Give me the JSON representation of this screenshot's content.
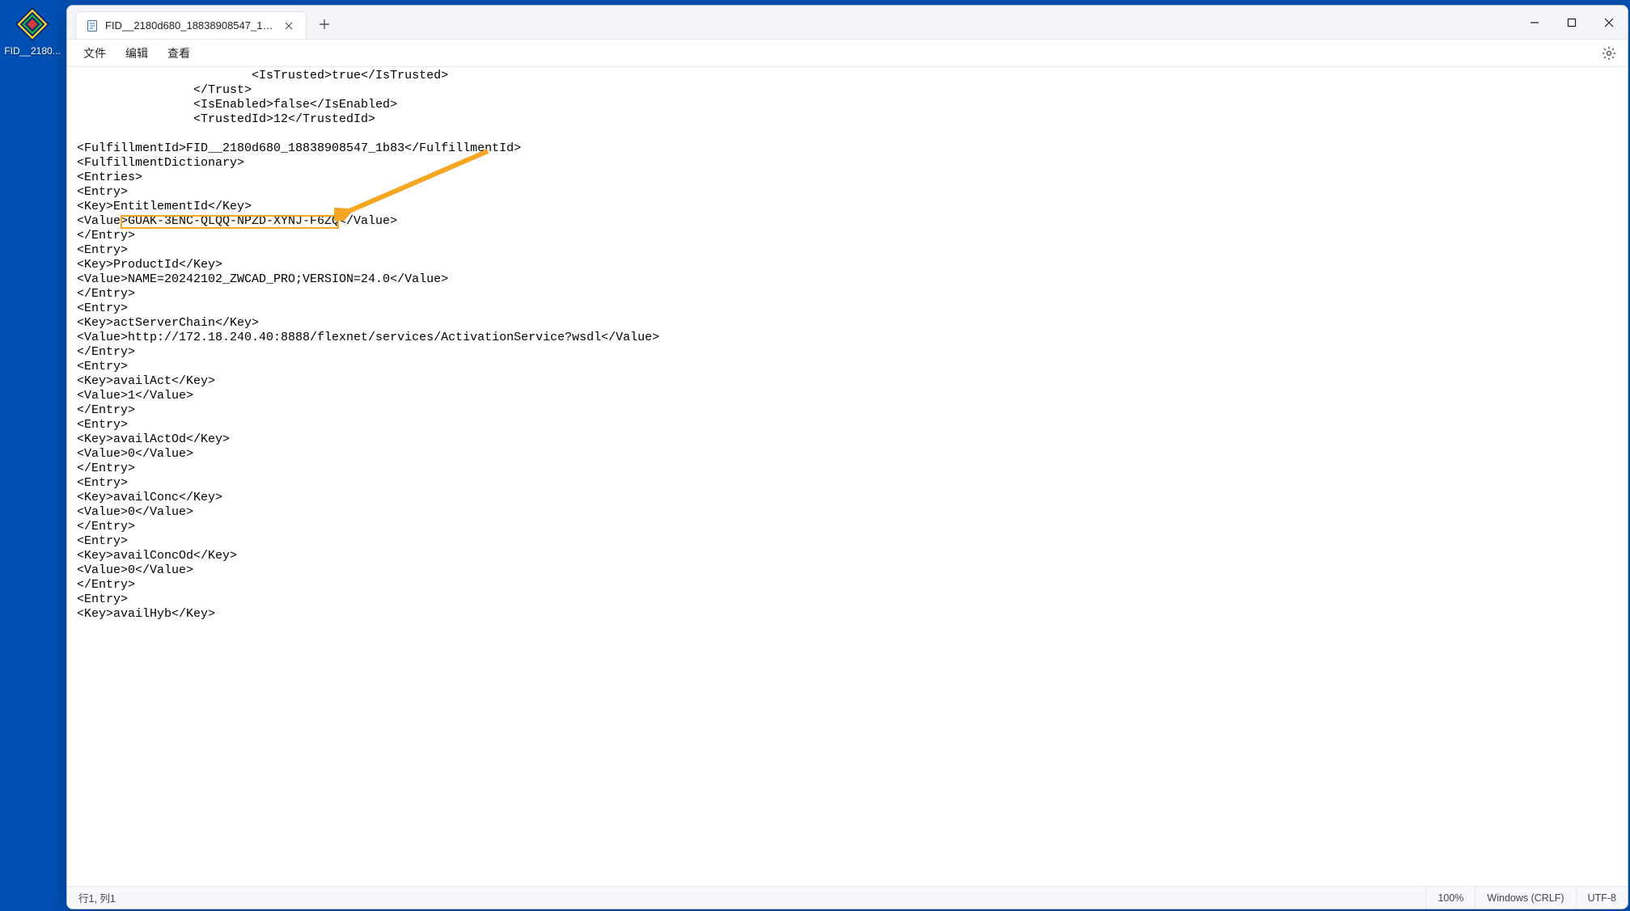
{
  "desktop": {
    "icon_label": "FID__2180..."
  },
  "window": {
    "tab_title": "FID__2180d680_18838908547_1b83"
  },
  "menubar": {
    "file": "文件",
    "edit": "编辑",
    "view": "查看"
  },
  "content": {
    "lines": [
      "                        <IsTrusted>true</IsTrusted>",
      "                </Trust>",
      "                <IsEnabled>false</IsEnabled>",
      "                <TrustedId>12</TrustedId>",
      "",
      "<FulfillmentId>FID__2180d680_18838908547_1b83</FulfillmentId>",
      "<FulfillmentDictionary>",
      "<Entries>",
      "<Entry>",
      "<Key>EntitlementId</Key>",
      "<Value>GUAK-3ENC-QLQQ-NPZD-XYNJ-F6ZQ</Value>",
      "</Entry>",
      "<Entry>",
      "<Key>ProductId</Key>",
      "<Value>NAME=20242102_ZWCAD_PRO;VERSION=24.0</Value>",
      "</Entry>",
      "<Entry>",
      "<Key>actServerChain</Key>",
      "<Value>http://172.18.240.40:8888/flexnet/services/ActivationService?wsdl</Value>",
      "</Entry>",
      "<Entry>",
      "<Key>availAct</Key>",
      "<Value>1</Value>",
      "</Entry>",
      "<Entry>",
      "<Key>availActOd</Key>",
      "<Value>0</Value>",
      "</Entry>",
      "<Entry>",
      "<Key>availConc</Key>",
      "<Value>0</Value>",
      "</Entry>",
      "<Entry>",
      "<Key>availConcOd</Key>",
      "<Value>0</Value>",
      "</Entry>",
      "<Entry>",
      "<Key>availHyb</Key>"
    ]
  },
  "statusbar": {
    "position": "行1, 列1",
    "zoom": "100%",
    "eol": "Windows (CRLF)",
    "encoding": "UTF-8"
  }
}
